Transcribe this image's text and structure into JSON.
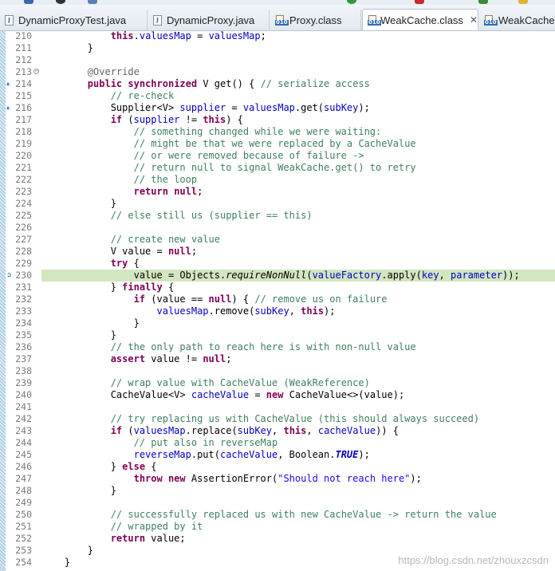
{
  "colors": {
    "keyword": "#7f0055",
    "comment": "#3f7f5f",
    "field": "#0000c0",
    "string": "#2a00ff",
    "annotation": "#646464",
    "current_line": "#d3e6bf"
  },
  "tabs": [
    {
      "label": "DynamicProxyTest.java",
      "icon": "java-file-icon",
      "active": false
    },
    {
      "label": "DynamicProxy.java",
      "icon": "java-file-icon",
      "active": false
    },
    {
      "label": "Proxy.class",
      "icon": "class-file-icon",
      "active": false
    },
    {
      "label": "WeakCache.class",
      "icon": "class-file-icon",
      "active": true,
      "close": "✕"
    },
    {
      "label": "WeakCacheS",
      "icon": "class-file-icon",
      "active": false
    }
  ],
  "editor": {
    "current_line": 230,
    "lines": [
      {
        "n": "210",
        "tokens": [
          [
            "",
            "            "
          ],
          [
            "kw",
            "this"
          ],
          [
            "",
            "."
          ],
          [
            "fd",
            "valuesMap"
          ],
          [
            "",
            " = "
          ],
          [
            "fd",
            "valuesMap"
          ],
          [
            "",
            ";"
          ]
        ]
      },
      {
        "n": "211",
        "tokens": [
          [
            "",
            "        }"
          ]
        ]
      },
      {
        "n": "212",
        "tokens": []
      },
      {
        "n": "213",
        "fold": true,
        "tokens": [
          [
            "",
            "        "
          ],
          [
            "an",
            "@Override"
          ]
        ]
      },
      {
        "n": "214",
        "marker": "override",
        "tokens": [
          [
            "",
            "        "
          ],
          [
            "kw",
            "public"
          ],
          [
            "",
            " "
          ],
          [
            "kw",
            "synchronized"
          ],
          [
            "",
            " V get() { "
          ],
          [
            "cm",
            "// serialize access"
          ]
        ]
      },
      {
        "n": "215",
        "tokens": [
          [
            "",
            "            "
          ],
          [
            "cm",
            "// re-check"
          ]
        ]
      },
      {
        "n": "216",
        "marker": "override",
        "tokens": [
          [
            "",
            "            Supplier<V> "
          ],
          [
            "fd",
            "supplier"
          ],
          [
            "",
            " = "
          ],
          [
            "fd",
            "valuesMap"
          ],
          [
            "",
            ".get("
          ],
          [
            "fd",
            "subKey"
          ],
          [
            "",
            ");"
          ]
        ]
      },
      {
        "n": "217",
        "tokens": [
          [
            "",
            "            "
          ],
          [
            "kw",
            "if"
          ],
          [
            "",
            " ("
          ],
          [
            "fd",
            "supplier"
          ],
          [
            "",
            " != "
          ],
          [
            "kw",
            "this"
          ],
          [
            "",
            ") {"
          ]
        ]
      },
      {
        "n": "218",
        "tokens": [
          [
            "",
            "                "
          ],
          [
            "cm",
            "// something changed while we were waiting:"
          ]
        ]
      },
      {
        "n": "219",
        "tokens": [
          [
            "",
            "                "
          ],
          [
            "cm",
            "// might be that we were replaced by a CacheValue"
          ]
        ]
      },
      {
        "n": "220",
        "tokens": [
          [
            "",
            "                "
          ],
          [
            "cm",
            "// or were removed because of failure ->"
          ]
        ]
      },
      {
        "n": "221",
        "tokens": [
          [
            "",
            "                "
          ],
          [
            "cm",
            "// return null to signal WeakCache.get() to retry"
          ]
        ]
      },
      {
        "n": "222",
        "tokens": [
          [
            "",
            "                "
          ],
          [
            "cm",
            "// the loop"
          ]
        ]
      },
      {
        "n": "223",
        "tokens": [
          [
            "",
            "                "
          ],
          [
            "kw",
            "return"
          ],
          [
            "",
            " "
          ],
          [
            "kw",
            "null"
          ],
          [
            "",
            ";"
          ]
        ]
      },
      {
        "n": "224",
        "tokens": [
          [
            "",
            "            }"
          ]
        ]
      },
      {
        "n": "225",
        "tokens": [
          [
            "",
            "            "
          ],
          [
            "cm",
            "// else still us (supplier == this)"
          ]
        ]
      },
      {
        "n": "226",
        "tokens": []
      },
      {
        "n": "227",
        "tokens": [
          [
            "",
            "            "
          ],
          [
            "cm",
            "// create new value"
          ]
        ]
      },
      {
        "n": "228",
        "tokens": [
          [
            "",
            "            V value = "
          ],
          [
            "kw",
            "null"
          ],
          [
            "",
            ";"
          ]
        ]
      },
      {
        "n": "229",
        "tokens": [
          [
            "",
            "            "
          ],
          [
            "kw",
            "try"
          ],
          [
            "",
            " {"
          ]
        ]
      },
      {
        "n": "230",
        "marker": "debug",
        "tokens": [
          [
            "",
            "                value = Objects."
          ],
          [
            "it",
            "requireNonNull"
          ],
          [
            "",
            "("
          ],
          [
            "fd",
            "valueFactory"
          ],
          [
            "",
            ".apply("
          ],
          [
            "fd",
            "key"
          ],
          [
            "",
            ", "
          ],
          [
            "fd",
            "parameter"
          ],
          [
            "",
            "));"
          ]
        ]
      },
      {
        "n": "231",
        "tokens": [
          [
            "",
            "            } "
          ],
          [
            "kw",
            "finally"
          ],
          [
            "",
            " {"
          ]
        ]
      },
      {
        "n": "232",
        "tokens": [
          [
            "",
            "                "
          ],
          [
            "kw",
            "if"
          ],
          [
            "",
            " (value == "
          ],
          [
            "kw",
            "null"
          ],
          [
            "",
            ") { "
          ],
          [
            "cm",
            "// remove us on failure"
          ]
        ]
      },
      {
        "n": "233",
        "tokens": [
          [
            "",
            "                    "
          ],
          [
            "fd",
            "valuesMap"
          ],
          [
            "",
            ".remove("
          ],
          [
            "fd",
            "subKey"
          ],
          [
            "",
            ", "
          ],
          [
            "kw",
            "this"
          ],
          [
            "",
            ");"
          ]
        ]
      },
      {
        "n": "234",
        "tokens": [
          [
            "",
            "                }"
          ]
        ]
      },
      {
        "n": "235",
        "tokens": [
          [
            "",
            "            }"
          ]
        ]
      },
      {
        "n": "236",
        "tokens": [
          [
            "",
            "            "
          ],
          [
            "cm",
            "// the only path to reach here is with non-null value"
          ]
        ]
      },
      {
        "n": "237",
        "tokens": [
          [
            "",
            "            "
          ],
          [
            "kw",
            "assert"
          ],
          [
            "",
            " value != "
          ],
          [
            "kw",
            "null"
          ],
          [
            "",
            ";"
          ]
        ]
      },
      {
        "n": "238",
        "tokens": []
      },
      {
        "n": "239",
        "tokens": [
          [
            "",
            "            "
          ],
          [
            "cm",
            "// wrap value with CacheValue (WeakReference)"
          ]
        ]
      },
      {
        "n": "240",
        "tokens": [
          [
            "",
            "            CacheValue<V> "
          ],
          [
            "fd",
            "cacheValue"
          ],
          [
            "",
            " = "
          ],
          [
            "kw",
            "new"
          ],
          [
            "",
            " CacheValue<>(value);"
          ]
        ]
      },
      {
        "n": "241",
        "tokens": []
      },
      {
        "n": "242",
        "tokens": [
          [
            "",
            "            "
          ],
          [
            "cm",
            "// try replacing us with CacheValue (this should always succeed)"
          ]
        ]
      },
      {
        "n": "243",
        "tokens": [
          [
            "",
            "            "
          ],
          [
            "kw",
            "if"
          ],
          [
            "",
            " ("
          ],
          [
            "fd",
            "valuesMap"
          ],
          [
            "",
            ".replace("
          ],
          [
            "fd",
            "subKey"
          ],
          [
            "",
            ", "
          ],
          [
            "kw",
            "this"
          ],
          [
            "",
            ", "
          ],
          [
            "fd",
            "cacheValue"
          ],
          [
            "",
            ")) {"
          ]
        ]
      },
      {
        "n": "244",
        "tokens": [
          [
            "",
            "                "
          ],
          [
            "cm",
            "// put also in reverseMap"
          ]
        ]
      },
      {
        "n": "245",
        "tokens": [
          [
            "",
            "                "
          ],
          [
            "fd",
            "reverseMap"
          ],
          [
            "",
            ".put("
          ],
          [
            "fd",
            "cacheValue"
          ],
          [
            "",
            ", Boolean."
          ],
          [
            "sti",
            "TRUE"
          ],
          [
            "",
            ");"
          ]
        ]
      },
      {
        "n": "246",
        "tokens": [
          [
            "",
            "            } "
          ],
          [
            "kw",
            "else"
          ],
          [
            "",
            " {"
          ]
        ]
      },
      {
        "n": "247",
        "tokens": [
          [
            "",
            "                "
          ],
          [
            "kw",
            "throw"
          ],
          [
            "",
            " "
          ],
          [
            "kw",
            "new"
          ],
          [
            "",
            " AssertionError("
          ],
          [
            "st",
            "\"Should not reach here\""
          ],
          [
            "",
            ");"
          ]
        ]
      },
      {
        "n": "248",
        "tokens": [
          [
            "",
            "            }"
          ]
        ]
      },
      {
        "n": "249",
        "tokens": []
      },
      {
        "n": "250",
        "tokens": [
          [
            "",
            "            "
          ],
          [
            "cm",
            "// successfully replaced us with new CacheValue -> return the value"
          ]
        ]
      },
      {
        "n": "251",
        "tokens": [
          [
            "",
            "            "
          ],
          [
            "cm",
            "// wrapped by it"
          ]
        ]
      },
      {
        "n": "252",
        "tokens": [
          [
            "",
            "            "
          ],
          [
            "kw",
            "return"
          ],
          [
            "",
            " value;"
          ]
        ]
      },
      {
        "n": "253",
        "tokens": [
          [
            "",
            "        }"
          ]
        ]
      },
      {
        "n": "254",
        "tokens": [
          [
            "",
            "    }"
          ]
        ]
      }
    ]
  },
  "watermark": "https://blog.csdn.net/zhouxzcsdn"
}
